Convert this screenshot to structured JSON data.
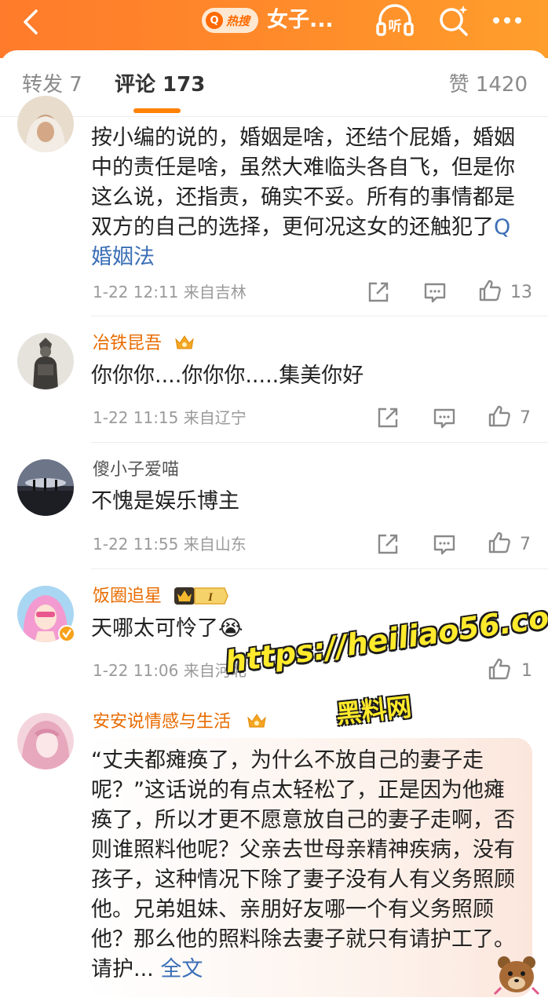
{
  "header": {
    "hot_label": "热搜",
    "title": "女子..."
  },
  "tabs": {
    "repost": "转发 7",
    "comment": "评论 173",
    "like": "赞 1420"
  },
  "comments": [
    {
      "text_main": "按小编的说的，婚姻是啥，还结个屁婚，婚姻中的责任是啥，虽然大难临头各自飞，但是你这么说，还指责，确实不妥。所有的事情都是双方的自己的选择，更何况这女的还触犯了",
      "topic": "婚姻法",
      "meta": "1-22 12:11  来自吉林",
      "likes": "13"
    },
    {
      "user": "冶铁昆吾",
      "text": "你你你....你你你.....集美你好",
      "meta": "1-22 11:15  来自辽宁",
      "likes": "7"
    },
    {
      "user": "傻小子爱喵",
      "text": "不愧是娱乐博主",
      "meta": "1-22 11:55  来自山东",
      "likes": "7"
    },
    {
      "user": "饭圈追星",
      "badge_level": "I",
      "text": "天哪太可怜了😭",
      "meta": "1-22 11:06  来自河北",
      "likes": "1"
    },
    {
      "user": "安安说情感与生活",
      "text": "“丈夫都瘫痪了，为什么不放自己的妻子走呢？”这话说的有点太轻松了，正是因为他瘫痪了，所以才更不愿意放自己的妻子走啊，否则谁照料他呢？父亲去世母亲精神疾病，没有孩子，这种情况下除了妻子没有人有义务照顾他。兄弟姐妹、亲朋好友哪一个有义务照顾他？那么他的照料除去妻子就只有请护工了。请护...",
      "more": "全文"
    }
  ],
  "watermark": {
    "url": "https://heiliao56.com",
    "name": "黑料网"
  },
  "colors": {
    "header_orange": "#ff8a2a",
    "accent": "#ff8200",
    "vip_name": "#e86b00",
    "link": "#3b6fb6"
  }
}
